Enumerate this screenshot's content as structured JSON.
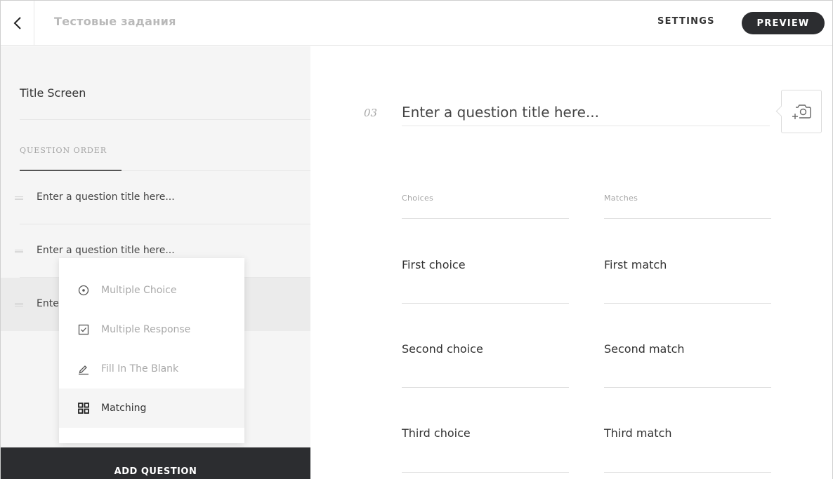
{
  "header": {
    "course_title": "Тестовые задания",
    "settings_label": "SETTINGS",
    "preview_label": "PREVIEW"
  },
  "sidebar": {
    "title_screen": "Title Screen",
    "question_order_label": "QUESTION ORDER",
    "questions": [
      {
        "title": "Enter a question title here..."
      },
      {
        "title": "Enter a question title here..."
      },
      {
        "title": "Ente"
      }
    ],
    "add_question_label": "ADD QUESTION"
  },
  "type_menu": {
    "items": [
      {
        "label": "Multiple Choice",
        "icon": "radio-icon"
      },
      {
        "label": "Multiple Response",
        "icon": "checkbox-icon"
      },
      {
        "label": "Fill In The Blank",
        "icon": "pencil-icon"
      },
      {
        "label": "Matching",
        "icon": "grid-icon",
        "selected": true
      }
    ]
  },
  "editor": {
    "question_number": "03",
    "question_title_placeholder": "Enter a question title here...",
    "choices_header": "Choices",
    "matches_header": "Matches",
    "pairs": [
      {
        "choice": "First choice",
        "match": "First match"
      },
      {
        "choice": "Second choice",
        "match": "Second match"
      },
      {
        "choice": "Third choice",
        "match": "Third match"
      }
    ]
  },
  "colors": {
    "dark": "#2c2d30",
    "sidebar_bg": "#f5f5f5",
    "muted_text": "#a9a9a9"
  }
}
